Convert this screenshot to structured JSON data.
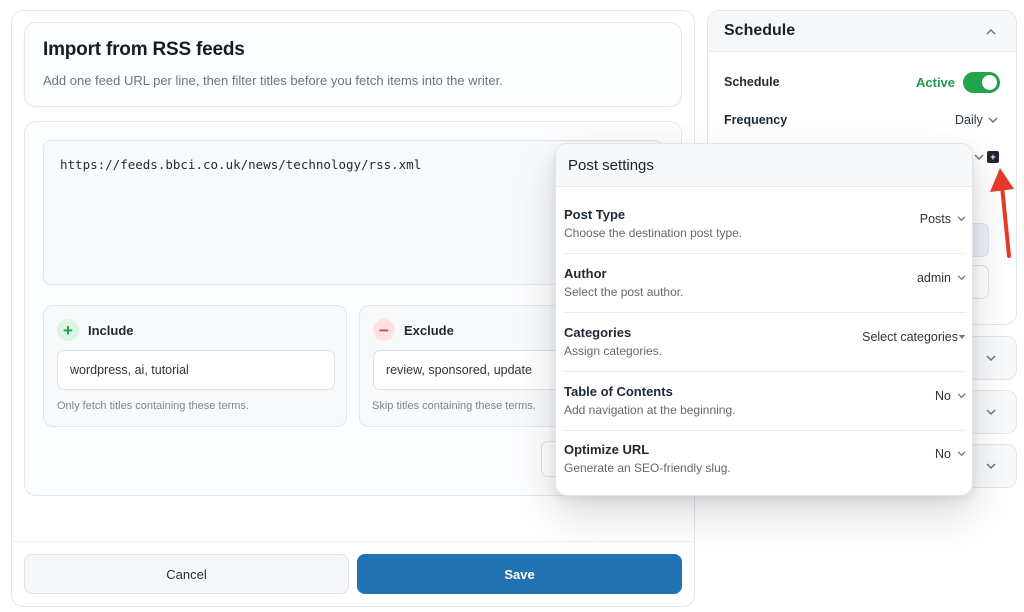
{
  "import": {
    "title": "Import from RSS feeds",
    "description": "Add one feed URL per line, then filter titles before you fetch items into the writer.",
    "feed_urls": "https://feeds.bbci.co.uk/news/technology/rss.xml",
    "include": {
      "label": "Include",
      "icon": "plus-icon",
      "value": "wordpress, ai, tutorial",
      "hint": "Only fetch titles containing these terms."
    },
    "exclude": {
      "label": "Exclude",
      "icon": "minus-icon",
      "value": "review, sponsored, update",
      "hint": "Skip titles containing these terms."
    }
  },
  "footer": {
    "cancel_label": "Cancel",
    "save_label": "Save"
  },
  "schedule": {
    "title": "Schedule",
    "schedule_label": "Schedule",
    "status": "Active",
    "enabled": true,
    "frequency_label": "Frequency",
    "frequency_value": "Daily"
  },
  "post_settings": {
    "title": "Post settings",
    "rows": [
      {
        "label": "Post Type",
        "description": "Choose the destination post type.",
        "value": "Posts"
      },
      {
        "label": "Author",
        "description": "Select the post author.",
        "value": "admin"
      },
      {
        "label": "Categories",
        "description": "Assign categories.",
        "value": "Select categories"
      },
      {
        "label": "Table of Contents",
        "description": "Add navigation at the beginning.",
        "value": "No"
      },
      {
        "label": "Optimize URL",
        "description": "Generate an SEO-friendly slug.",
        "value": "No"
      }
    ]
  },
  "colors": {
    "accent": "#2271b1",
    "active_green": "#22a34c",
    "annotation_red": "#e8392b"
  }
}
